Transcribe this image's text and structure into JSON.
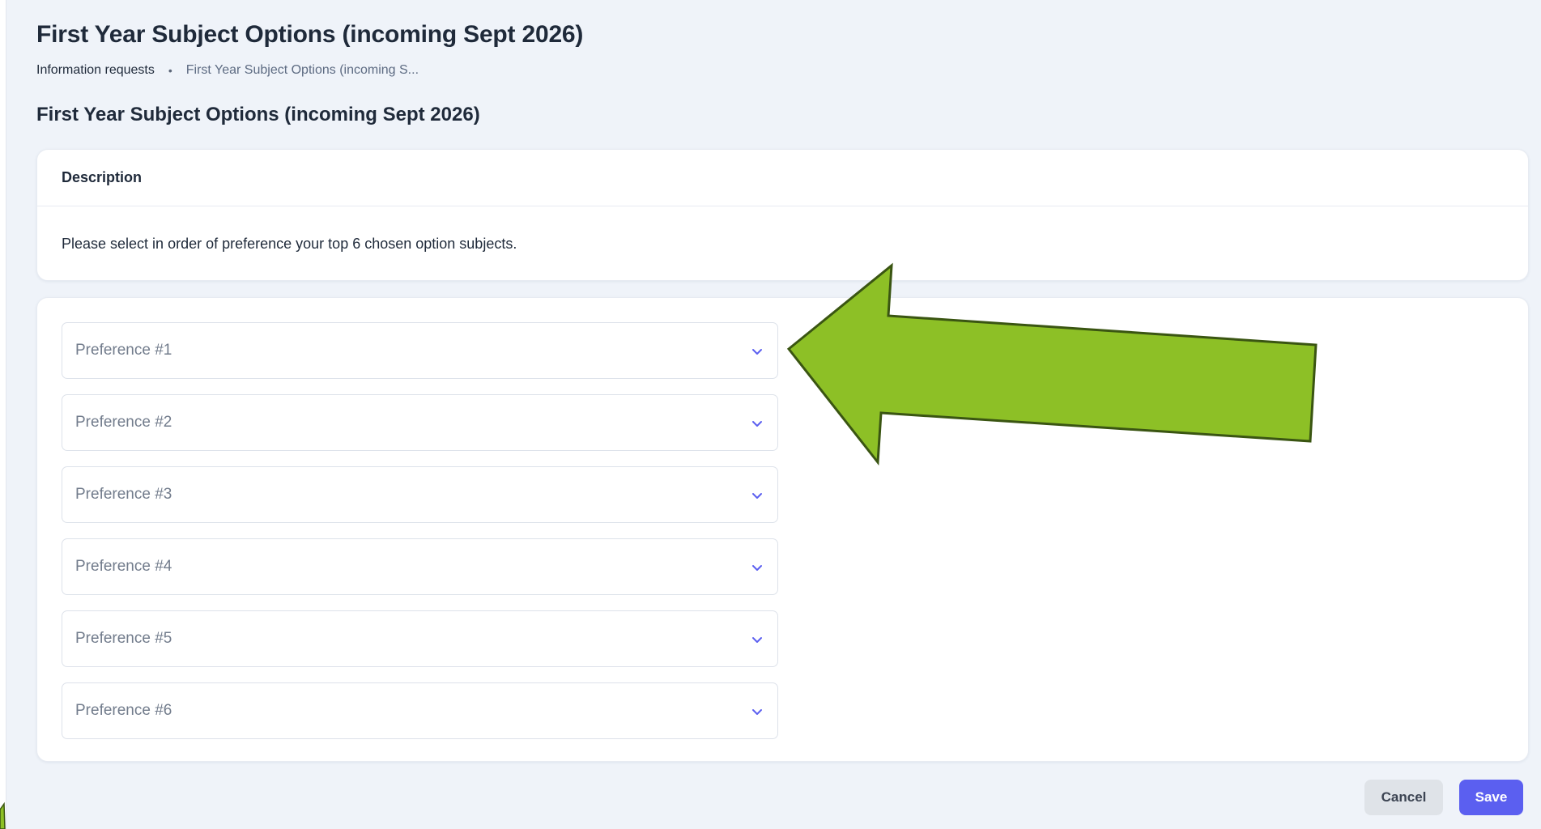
{
  "page": {
    "title": "First Year Subject Options (incoming Sept 2026)",
    "section_title": "First Year Subject Options (incoming Sept 2026)"
  },
  "breadcrumb": {
    "link": "Information requests",
    "separator": "•",
    "current": "First Year Subject Options (incoming S..."
  },
  "description": {
    "header": "Description",
    "text": "Please select in order of preference your top 6 chosen option subjects."
  },
  "preferences": [
    {
      "placeholder": "Preference #1"
    },
    {
      "placeholder": "Preference #2"
    },
    {
      "placeholder": "Preference #3"
    },
    {
      "placeholder": "Preference #4"
    },
    {
      "placeholder": "Preference #5"
    },
    {
      "placeholder": "Preference #6"
    }
  ],
  "actions": {
    "cancel_label": "Cancel",
    "save_label": "Save"
  },
  "colors": {
    "accent": "#5b5ff0",
    "annotation_arrow": "#8dc026",
    "page_background": "#eff3f9"
  },
  "icons": {
    "select_chevron": "chevron-down-icon",
    "annotation": "annotation-arrow"
  }
}
